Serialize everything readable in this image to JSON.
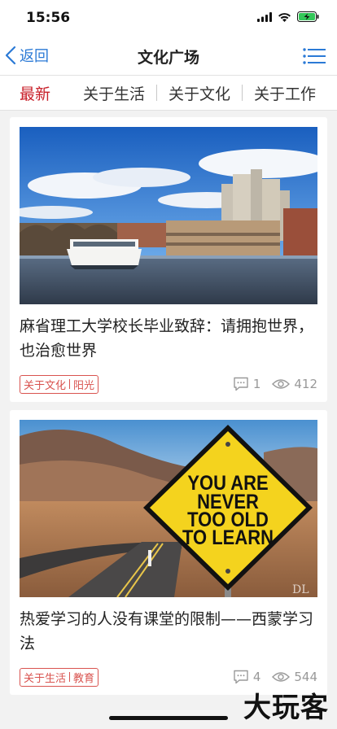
{
  "status_bar": {
    "time": "15:56"
  },
  "nav": {
    "back_label": "返回",
    "title": "文化广场"
  },
  "tabs": [
    {
      "label": "最新"
    },
    {
      "label": "关于生活"
    },
    {
      "label": "关于文化"
    },
    {
      "label": "关于工作"
    }
  ],
  "articles": [
    {
      "title": "麻省理工大学校长毕业致辞：请拥抱世界，也治愈世界",
      "tag_category": "关于文化",
      "tag_topic": "阳光",
      "comments": "1",
      "views": "412"
    },
    {
      "title": "热爱学习的人没有课堂的限制——西蒙学习法",
      "tag_category": "关于生活",
      "tag_topic": "教育",
      "comments": "4",
      "views": "544",
      "image_sign_text": [
        "YOU ARE",
        "NEVER",
        "TOO OLD",
        "TO LEARN"
      ],
      "image_corner_mark": "DL"
    }
  ],
  "watermark": "大玩客"
}
